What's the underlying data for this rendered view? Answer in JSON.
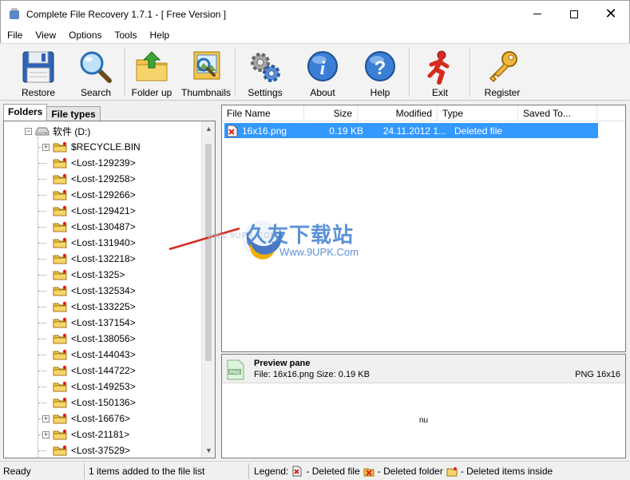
{
  "window": {
    "title": "Complete File Recovery 1.7.1 - [ Free Version ]"
  },
  "menu": [
    "File",
    "View",
    "Options",
    "Tools",
    "Help"
  ],
  "toolbar": {
    "restore": "Restore",
    "search": "Search",
    "folder_up": "Folder up",
    "thumbnails": "Thumbnails",
    "settings": "Settings",
    "about": "About",
    "help": "Help",
    "exit": "Exit",
    "register": "Register"
  },
  "left_tabs": {
    "folders": "Folders",
    "file_types": "File types"
  },
  "tree": {
    "drive": "软件 (D:)",
    "items": [
      "$RECYCLE.BIN",
      "<Lost-129239>",
      "<Lost-129258>",
      "<Lost-129266>",
      "<Lost-129421>",
      "<Lost-130487>",
      "<Lost-131940>",
      "<Lost-132218>",
      "<Lost-1325>",
      "<Lost-132534>",
      "<Lost-133225>",
      "<Lost-137154>",
      "<Lost-138056>",
      "<Lost-144043>",
      "<Lost-144722>",
      "<Lost-149253>",
      "<Lost-150136>",
      "<Lost-16676>",
      "<Lost-21181>",
      "<Lost-37529>"
    ]
  },
  "file_list": {
    "columns": [
      "File Name",
      "Size",
      "Modified",
      "Type",
      "Saved To..."
    ],
    "rows": [
      {
        "name": "16x16.png",
        "size": "0.19 KB",
        "modified": "24.11.2012 1...",
        "type": "Deleted file",
        "saved_to": ""
      }
    ]
  },
  "preview": {
    "title": "Preview pane",
    "info": "File: 16x16.png   Size: 0.19 KB",
    "type": "PNG 16x16",
    "content": "nu"
  },
  "status": {
    "ready": "Ready",
    "count": "1 items added to the file list",
    "legend_label": "Legend:",
    "deleted_file": "- Deleted file",
    "deleted_folder": "- Deleted folder",
    "deleted_inside": "- Deleted items inside"
  },
  "watermark": {
    "title": "久友下载站",
    "url": "Www.9UPK.Com",
    "faint": "www.9UPK.COM"
  },
  "colors": {
    "selection": "#3399ff",
    "accent_blue": "#2f6fd0"
  }
}
